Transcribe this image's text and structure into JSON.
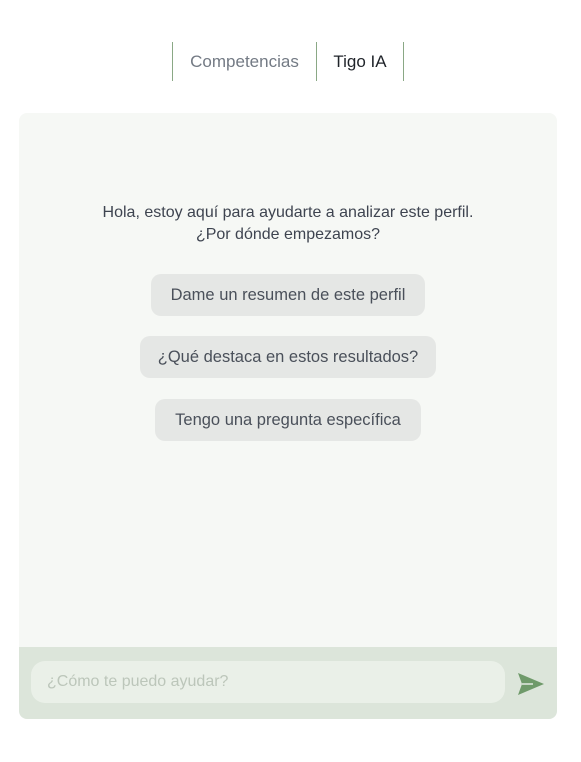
{
  "tabs": [
    {
      "label": "Competencias",
      "active": false
    },
    {
      "label": "Tigo IA",
      "active": true
    }
  ],
  "chat": {
    "greeting_line1": "Hola, estoy aquí para ayudarte a analizar este perfil.",
    "greeting_line2": "¿Por dónde empezamos?",
    "suggestions": [
      "Dame un resumen de este perfil",
      "¿Qué destaca en estos resultados?",
      "Tengo una pregunta específica"
    ]
  },
  "input": {
    "value": "",
    "placeholder": "¿Cómo te puedo ayudar?"
  },
  "icons": {
    "send": "send-icon"
  },
  "colors": {
    "accent": "#6f9a6a",
    "panel_bg": "#f6f8f5",
    "input_bar_bg": "#dce5da",
    "suggestion_bg": "#e5e7e5",
    "tab_divider": "#8aa885"
  }
}
